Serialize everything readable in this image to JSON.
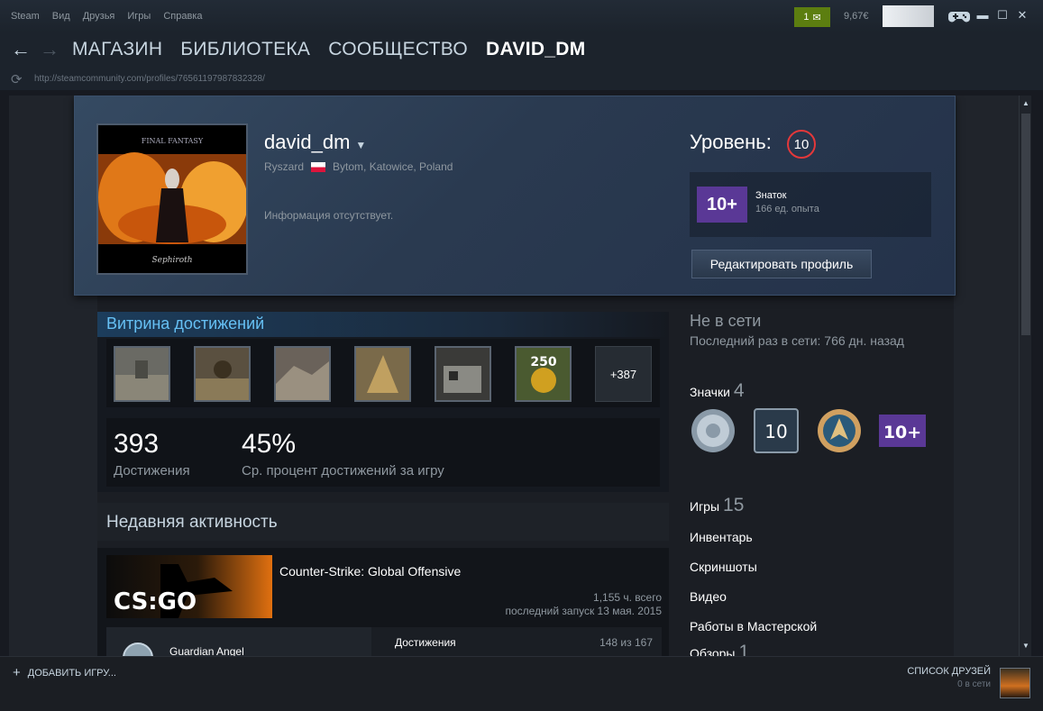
{
  "menu": [
    "Steam",
    "Вид",
    "Друзья",
    "Игры",
    "Справка"
  ],
  "top": {
    "notifications": "1",
    "balance": "9,67€"
  },
  "nav": {
    "items": [
      "МАГАЗИН",
      "БИБЛИОТЕКА",
      "СООБЩЕСТВО",
      "DAVID_DM"
    ]
  },
  "url": "http://steamcommunity.com/profiles/76561197987832328/",
  "profile": {
    "persona": "david_dm",
    "real_name": "Ryszard",
    "location": "Bytom, Katowice, Poland",
    "summary": "Информация отсутствует.",
    "level_label": "Уровень:",
    "level": "10",
    "badge_text": "10+",
    "badge_name": "Знаток",
    "badge_xp": "166 ед. опыта",
    "edit_button": "Редактировать профиль"
  },
  "showcase": {
    "title": "Витрина достижений",
    "more": "+387",
    "ach_250_label": "250",
    "count": "393",
    "count_label": "Достижения",
    "avg": "45%",
    "avg_label": "Ср. процент достижений за игру"
  },
  "recent": {
    "title": "Недавняя активность",
    "game_name": "Counter-Strike: Global Offensive",
    "hours": "1,155 ч. всего",
    "last_played": "последний запуск 13 мая. 2015",
    "capsule_text": "CS:GO",
    "achievement_name": "Guardian Angel",
    "achievements_label": "Достижения",
    "achievements_value": "148 из 167"
  },
  "side": {
    "status": "Не в сети",
    "last_online": "Последний раз в сети: 766 дн. назад",
    "badges_label": "Значки",
    "badges_count": "4",
    "badge_level_text": "10",
    "badge_plus_text": "10+",
    "games_label": "Игры",
    "games_count": "15",
    "inventory": "Инвентарь",
    "screenshots": "Скриншоты",
    "videos": "Видео",
    "workshop": "Работы в Мастерской",
    "reviews_label": "Обзоры",
    "reviews_count": "1"
  },
  "bottom": {
    "add_game": "ДОБАВИТЬ ИГРУ...",
    "friends_list": "СПИСОК ДРУЗЕЙ",
    "friends_online": "0 в сети"
  },
  "colors": {
    "accent_blue": "#66c0f4",
    "level_ring": "#e4383a",
    "notification_green": "#5c7e10",
    "badge_purple": "#5a3896"
  }
}
